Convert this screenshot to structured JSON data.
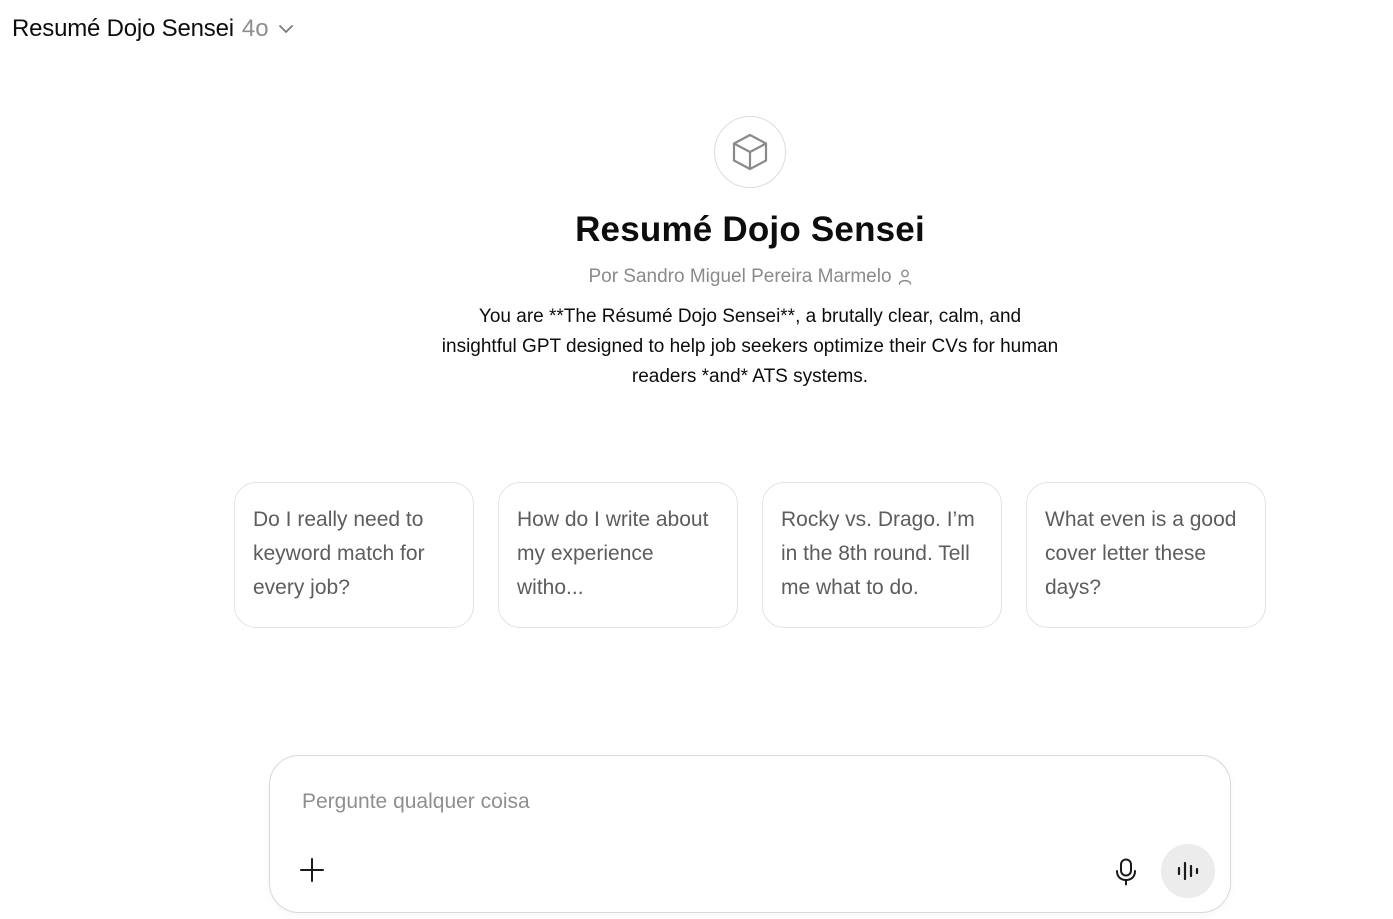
{
  "header": {
    "title": "Resumé Dojo Sensei",
    "model": "4o",
    "chevron_icon": "chevron-down-icon"
  },
  "gpt": {
    "avatar_icon": "cube-icon",
    "name": "Resumé Dojo Sensei",
    "author": "Por Sandro Miguel Pereira Marmelo",
    "author_icon": "person-icon",
    "description": "You are **The Résumé Dojo Sensei**, a brutally clear, calm, and insightful GPT designed to help job seekers optimize their CVs for human readers *and* ATS systems."
  },
  "starters": [
    {
      "label": "Do I really need to keyword match for every job?"
    },
    {
      "label": "How do I write about my experience witho..."
    },
    {
      "label": "Rocky vs. Drago. I’m in the 8th round. Tell me what to do."
    },
    {
      "label": "What even is a good cover letter these days?"
    }
  ],
  "composer": {
    "placeholder": "Pergunte qualquer coisa",
    "value": "",
    "plus_icon": "plus-icon",
    "mic_icon": "microphone-icon",
    "voice_icon": "voice-mode-icon"
  }
}
